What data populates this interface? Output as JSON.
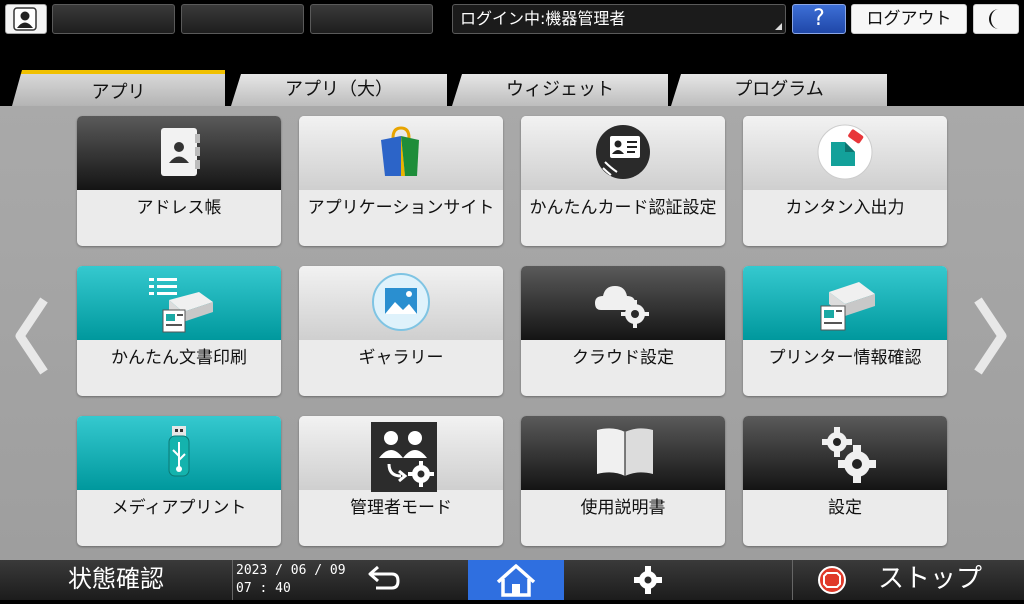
{
  "topbar": {
    "login_status": "ログイン中:機器管理者",
    "help_label": "?",
    "logout_label": "ログアウト"
  },
  "tabs": [
    {
      "label": "アプリ",
      "active": true
    },
    {
      "label": "アプリ（大）",
      "active": false
    },
    {
      "label": "ウィジェット",
      "active": false
    },
    {
      "label": "プログラム",
      "active": false
    }
  ],
  "apps": [
    {
      "label": "アドレス帳",
      "icon": "address-book-icon",
      "style": "dark"
    },
    {
      "label": "アプリケーションサイト",
      "icon": "shopping-bag-icon",
      "style": "light"
    },
    {
      "label": "かんたんカード認証設定",
      "icon": "id-card-icon",
      "style": "light"
    },
    {
      "label": "カンタン入出力",
      "icon": "easy-io-icon",
      "style": "light"
    },
    {
      "label": "かんたん文書印刷",
      "icon": "document-print-icon",
      "style": "teal"
    },
    {
      "label": "ギャラリー",
      "icon": "gallery-icon",
      "style": "light"
    },
    {
      "label": "クラウド設定",
      "icon": "cloud-settings-icon",
      "style": "dark"
    },
    {
      "label": "プリンター情報確認",
      "icon": "printer-info-icon",
      "style": "teal"
    },
    {
      "label": "メディアプリント",
      "icon": "usb-icon",
      "style": "teal"
    },
    {
      "label": "管理者モード",
      "icon": "admin-mode-icon",
      "style": "light"
    },
    {
      "label": "使用説明書",
      "icon": "manual-book-icon",
      "style": "dark"
    },
    {
      "label": "設定",
      "icon": "gears-icon",
      "style": "dark"
    }
  ],
  "bottombar": {
    "status_label": "状態確認",
    "date": "2023 / 06 / 09",
    "time": "07 : 40",
    "stop_label": "ストップ"
  },
  "colors": {
    "accent_tab": "#f0c000",
    "home_active": "#2f6fe0",
    "teal": "#00a3a8",
    "stop_red": "#e03a2a"
  }
}
